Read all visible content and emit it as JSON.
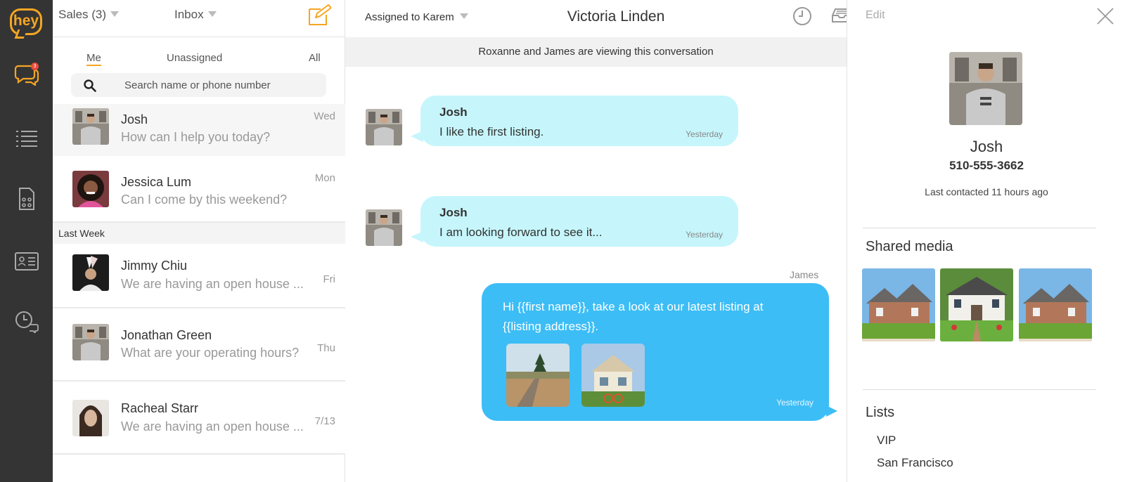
{
  "brand": {
    "logo_text": "hey",
    "accent": "#f5a623"
  },
  "rail": {
    "items": [
      {
        "icon": "chat-bubbles-icon",
        "badge": "3"
      },
      {
        "icon": "list-icon"
      },
      {
        "icon": "clipboard-icon"
      },
      {
        "icon": "contact-card-icon"
      },
      {
        "icon": "clock-chat-icon"
      }
    ]
  },
  "list_header": {
    "team": "Sales (3)",
    "folder": "Inbox"
  },
  "filters": {
    "me": "Me",
    "unassigned": "Unassigned",
    "all": "All"
  },
  "search": {
    "placeholder": "Search name or phone number"
  },
  "conversations": [
    {
      "name": "Josh",
      "preview": "How can I help you today?",
      "date": "Wed"
    },
    {
      "name": "Jessica Lum",
      "preview": "Can I come by this weekend?",
      "date": "Mon"
    },
    {
      "name": "Jimmy Chiu",
      "preview": "We are having an open house ...",
      "date": "Fri"
    },
    {
      "name": "Jonathan Green",
      "preview": "What are your operating hours?",
      "date": "Thu"
    },
    {
      "name": "Racheal Starr",
      "preview": "We are having an open house ...",
      "date": "7/13"
    }
  ],
  "section_last_week": "Last Week",
  "chat": {
    "assigned": "Assigned to Karem",
    "title": "Victoria Linden",
    "viewing": "Roxanne and James are viewing this conversation",
    "messages": [
      {
        "from": "Josh",
        "text": "I like the first listing.",
        "time": "Yesterday"
      },
      {
        "from": "Josh",
        "text": "I am looking forward to see it...",
        "time": "Yesterday"
      }
    ],
    "outgoing": {
      "sender": "James",
      "text": "Hi {{first name}}, take a look at our latest listing at {{listing address}}.",
      "time": "Yesterday"
    }
  },
  "panel": {
    "edit": "Edit",
    "name": "Josh",
    "phone": "510-555-3662",
    "last_contacted": "Last contacted 11 hours ago",
    "shared_media_title": "Shared media",
    "lists_title": "Lists",
    "lists": [
      "VIP",
      "San Francisco"
    ]
  }
}
